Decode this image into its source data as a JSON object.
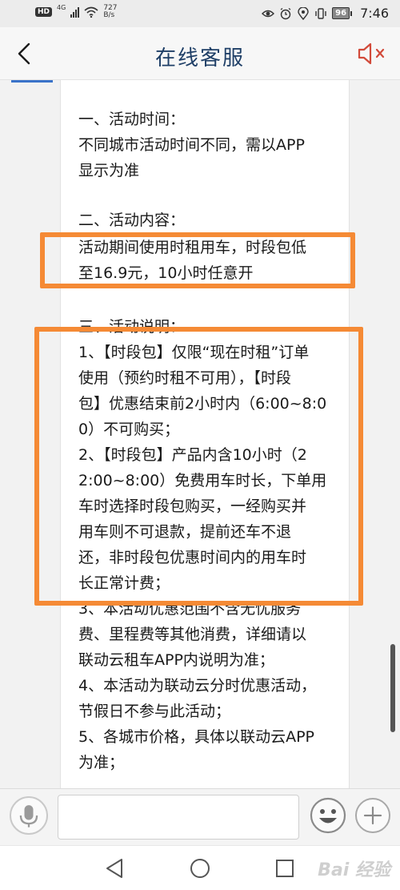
{
  "status_bar": {
    "hd": "HD",
    "network": "4G",
    "speed_value": "727",
    "speed_unit": "B/s",
    "battery": "96",
    "time": "7:46"
  },
  "header": {
    "title": "在线客服"
  },
  "message": {
    "lines": [
      "一、活动时间：",
      "不同城市活动时间不同，需以APP",
      "显示为准",
      "二、活动内容：",
      "活动期间使用时租用车，时段包低",
      "至16.9元，10小时任意开",
      "三、活动说明：",
      "1、【时段包】仅限“现在时租”订单",
      "使用（预约时租不可用），【时段",
      "包】优惠结束前2小时内（6:00~8:0",
      "0）不可购买；",
      "2、【时段包】产品内含10小时（2",
      "2:00~8:00）免费用车时长，下单用",
      "车时选择时段包购买，一经购买并",
      "用车则不可退款，提前还车不退",
      "还，非时段包优惠时间内的用车时",
      "长正常计费；",
      "3、本活动优惠范围不含无忧服务",
      "费、里程费等其他消费，详细请以",
      "联动云租车APP内说明为准；",
      "4、本活动为联动云分时优惠活动，",
      "节假日不参与此活动；",
      "5、各城市价格，具体以联动云APP",
      "为准；"
    ]
  },
  "input_bar": {
    "placeholder": ""
  },
  "watermark": "Bai 经验",
  "colors": {
    "title": "#1f3f67",
    "highlight": "#f58a35",
    "mute_icon": "#d24a3a"
  }
}
